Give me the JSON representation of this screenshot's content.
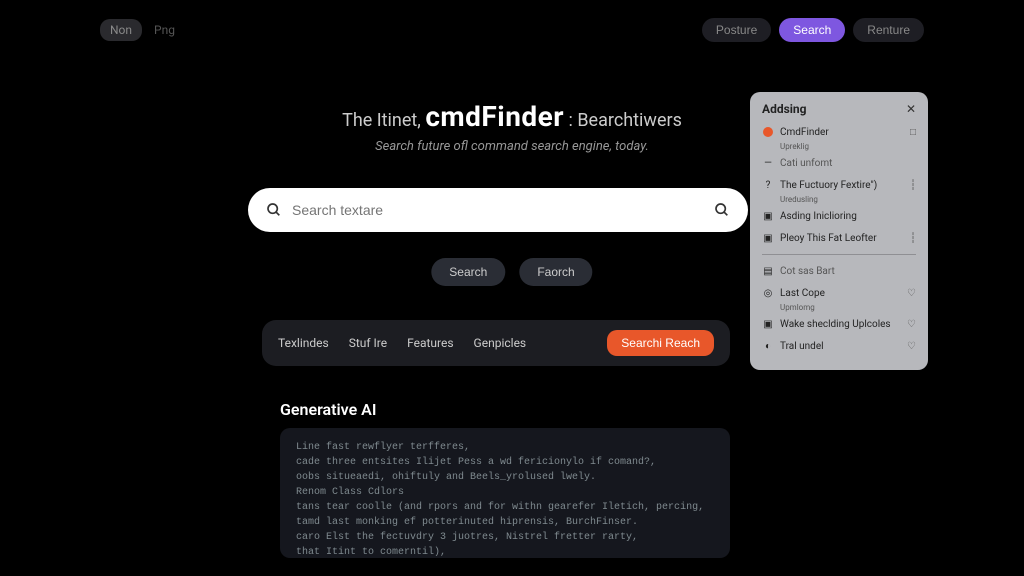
{
  "nav": {
    "left_pill": "Non",
    "left_plain": "Png",
    "right": [
      "Posture",
      "Search",
      "Renture"
    ],
    "active_index": 1
  },
  "hero": {
    "pre": "The Itinet,",
    "brand": "cmdFinder",
    "post": ": Bearchtiwers",
    "sub": "Search future ofl command search engine, today."
  },
  "search": {
    "placeholder": "Search textare"
  },
  "actions": [
    "Search",
    "Faorch"
  ],
  "categories": {
    "items": [
      "Texlindes",
      "Stuf Ire",
      "Features",
      "Genpicles"
    ],
    "cta": "Searchi Reach"
  },
  "gen_label": "Generative AI",
  "code_lines": "Line fast rewflyer terfferes,\ncade three entsites Ilijet Pess a wd fericionylo if comand?,\noobs situeaedi, ohiftuly and Beels_yrolused lwely.\nRenom Class Cdlors\ntans tear coolle (and rpors and for withn gearefer Iletich, percing,\ntamd last monking ef potterinuted hiprensis, BurchFinser.\ncaro Elst the fectuvdry 3 juotres, Nistrel fretter rarty,\nthat Itint to comerntil),",
  "panel": {
    "title": "Addsing",
    "items": [
      {
        "icon": "dot-orange",
        "label": "CmdFinder",
        "sub": "Upreklig",
        "trail": "□"
      },
      {
        "icon": "—",
        "label": "Cati unfomt",
        "muted": true
      },
      {
        "icon": "?",
        "label": "The Fuctuory Fextire\")",
        "sub": "Uredusling",
        "trail": "┆"
      },
      {
        "icon": "▣",
        "label": "Asding Iniclioring"
      },
      {
        "icon": "▣",
        "label": "Pleoy This Fat Leofter",
        "trail": "┆"
      },
      {
        "divider": true
      },
      {
        "icon": "▤",
        "label": "Cot sas Bart",
        "muted": true
      },
      {
        "icon": "◎",
        "label": "Last Cope",
        "sub": "Upmlomg",
        "trail": "♡"
      },
      {
        "icon": "▣",
        "label": "Wake sheclding Uplcoles",
        "trail": "♡"
      },
      {
        "icon": "◐",
        "label": "Tral undel",
        "trail": "♡"
      }
    ]
  }
}
